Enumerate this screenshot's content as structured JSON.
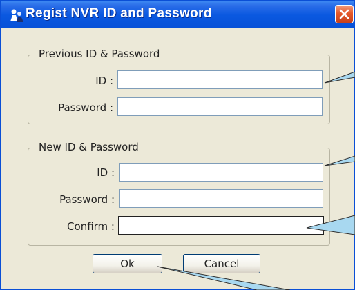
{
  "window": {
    "title": "Regist NVR ID and Password"
  },
  "previous_group": {
    "legend": "Previous ID & Password",
    "id_label": "ID :",
    "id_value": "",
    "password_label": "Password :",
    "password_value": ""
  },
  "new_group": {
    "legend": "New ID & Password",
    "id_label": "ID :",
    "id_value": "",
    "password_label": "Password :",
    "password_value": "",
    "confirm_label": "Confirm :",
    "confirm_value": ""
  },
  "buttons": {
    "ok_label": "Ok",
    "cancel_label": "Cancel"
  },
  "icons": {
    "app": "network-people-icon",
    "close": "close-icon"
  },
  "colors": {
    "titlebar": "#0a58e0",
    "close_button": "#e5592b",
    "callout_fill": "#a8d8f0"
  }
}
